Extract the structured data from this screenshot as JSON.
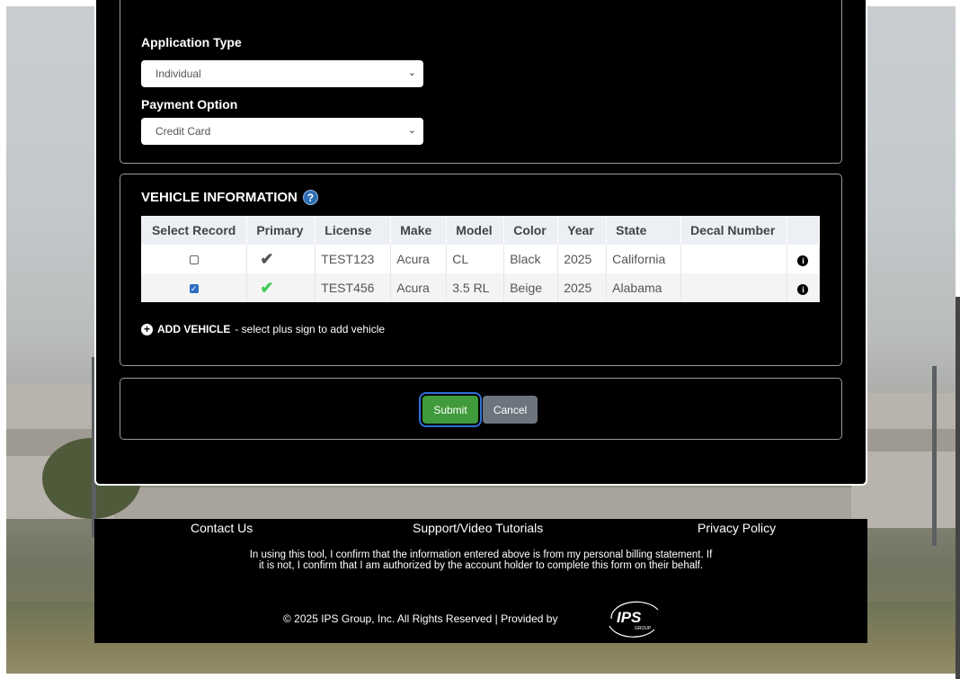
{
  "application": {
    "type_label": "Application Type",
    "type_value": "Individual",
    "payment_label": "Payment Option",
    "payment_value": "Credit Card"
  },
  "vehicle": {
    "section_title": "VEHICLE INFORMATION",
    "help_glyph": "?",
    "columns": [
      "Select Record",
      "Primary",
      "License",
      "Make",
      "Model",
      "Color",
      "Year",
      "State",
      "Decal Number",
      ""
    ],
    "rows": [
      {
        "selected": false,
        "primary_icon": "checkmark-grey",
        "license": "TEST123",
        "make": "Acura",
        "model": "CL",
        "color": "Black",
        "year": "2025",
        "state": "California",
        "decal": ""
      },
      {
        "selected": true,
        "primary_icon": "checkmark-green",
        "license": "TEST456",
        "make": "Acura",
        "model": "3.5 RL",
        "color": "Beige",
        "year": "2025",
        "state": "Alabama",
        "decal": ""
      }
    ],
    "add_bold": "ADD VEHICLE",
    "add_rest": " - select plus sign to add vehicle"
  },
  "actions": {
    "submit": "Submit",
    "cancel": "Cancel"
  },
  "footer": {
    "contact": "Contact Us",
    "support": "Support/Video Tutorials",
    "privacy": "Privacy Policy",
    "note": "In using this tool, I confirm that the information entered above is from my personal billing statement. If it is not, I confirm that I am authorized by the account holder to complete this form on their behalf.",
    "copyright": "© 2025 IPS Group, Inc. All Rights Reserved  | Provided by",
    "logo_text": "IPS",
    "logo_sub": "GROUP"
  },
  "colors": {
    "submit": "#3f9b3b",
    "cancel": "#6c757d",
    "help": "#2e6db5",
    "primary_check": "#43c95a"
  }
}
